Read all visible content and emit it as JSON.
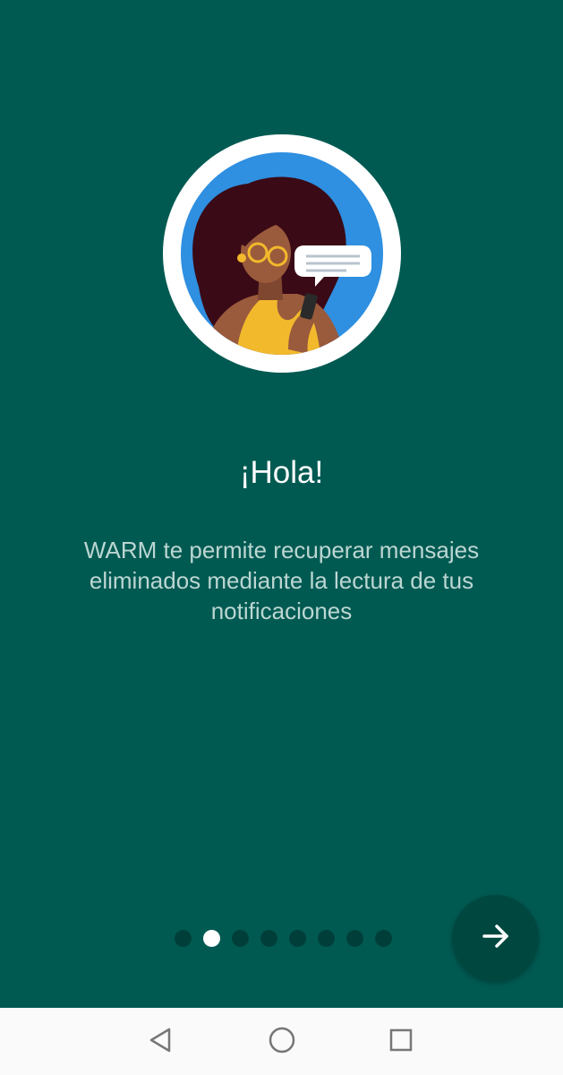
{
  "onboarding": {
    "title": "¡Hola!",
    "description": "WARM te permite recuperar mensajes eliminados mediante la lectura de tus notificaciones",
    "page_indicator": {
      "total_pages": 8,
      "current_page": 2
    },
    "next_button_icon": "arrow-right-icon",
    "illustration_icon": "woman-with-phone-illustration"
  },
  "system_nav": {
    "back_icon": "triangle-back-icon",
    "home_icon": "circle-home-icon",
    "recents_icon": "square-recents-icon"
  },
  "colors": {
    "background": "#005a52",
    "fab": "#00483f",
    "dot_inactive": "#003f39",
    "dot_active": "#ffffff",
    "navbar": "#fafafa"
  }
}
